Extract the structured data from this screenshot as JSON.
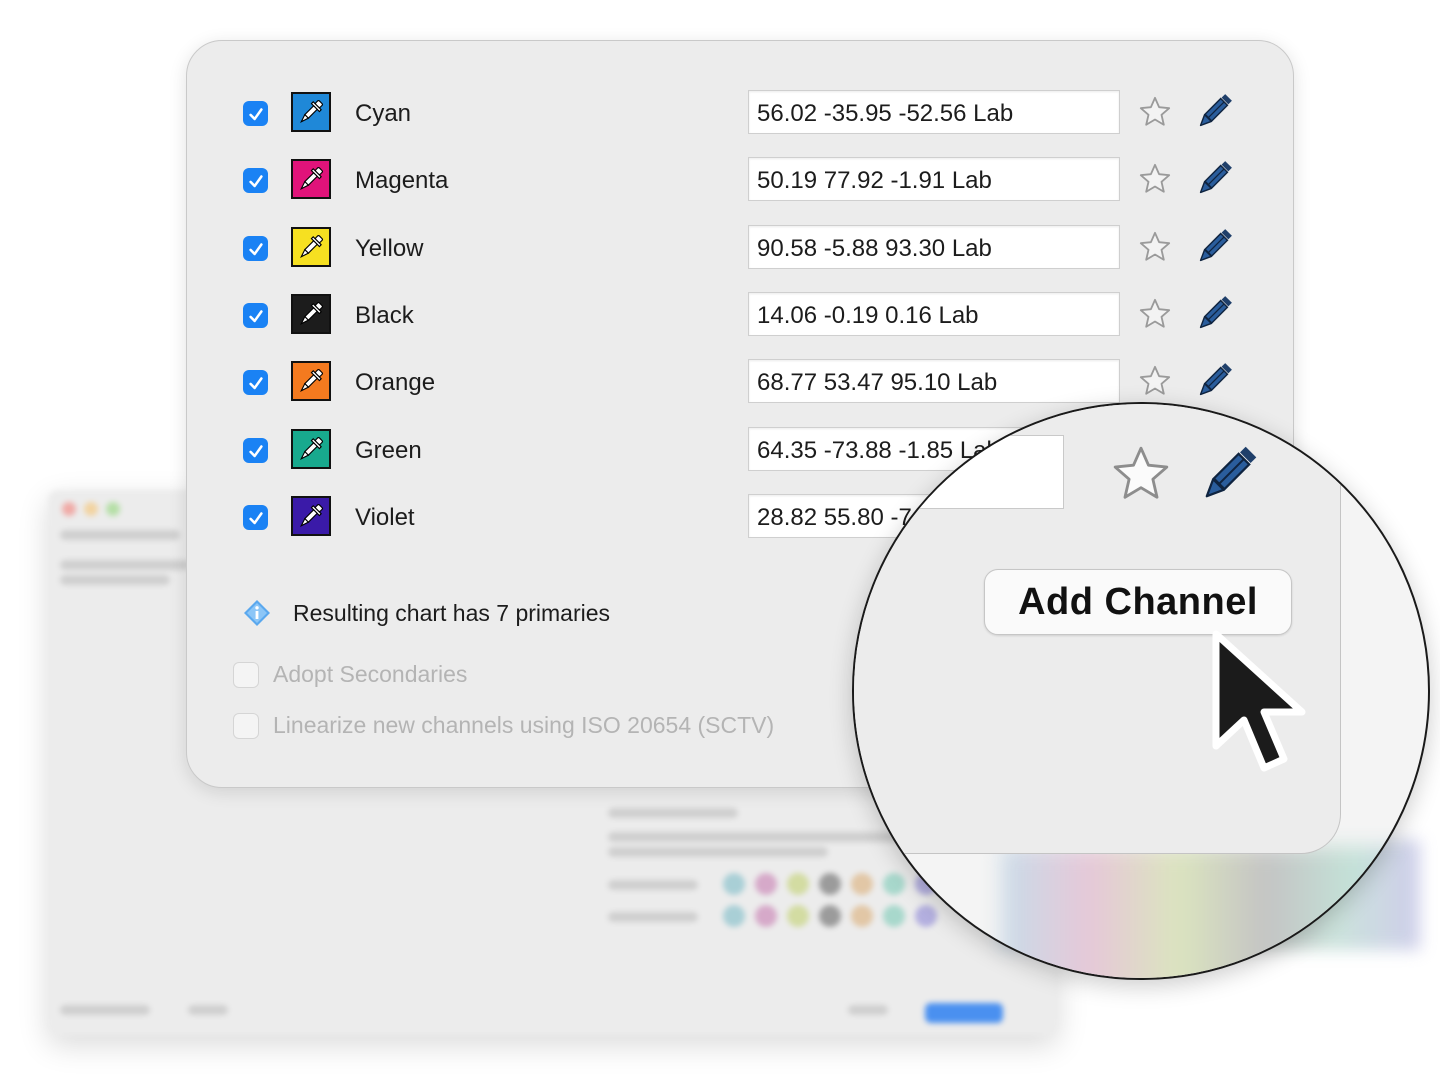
{
  "channels": [
    {
      "name": "Cyan",
      "value": "56.02 -35.95 -52.56 Lab",
      "color": "#1f88d8",
      "checked": true
    },
    {
      "name": "Magenta",
      "value": "50.19 77.92 -1.91 Lab",
      "color": "#e0137a",
      "checked": true
    },
    {
      "name": "Yellow",
      "value": "90.58 -5.88 93.30 Lab",
      "color": "#f6e021",
      "checked": true
    },
    {
      "name": "Black",
      "value": "14.06 -0.19 0.16 Lab",
      "color": "#1c1c1c",
      "checked": true
    },
    {
      "name": "Orange",
      "value": "68.77 53.47 95.10 Lab",
      "color": "#f47a1f",
      "checked": true
    },
    {
      "name": "Green",
      "value": "64.35 -73.88 -1.85 Lab",
      "color": "#18a98e",
      "checked": true
    },
    {
      "name": "Violet",
      "value": "28.82 55.80 -7",
      "color": "#3a1aa8",
      "checked": true
    }
  ],
  "info": {
    "text": "Resulting chart has 7 primaries",
    "icon": "info-diamond-icon"
  },
  "options": {
    "adopt_secondaries": "Adopt Secondaries",
    "linearize": "Linearize new channels using ISO 20654 (SCTV)"
  },
  "magnifier": {
    "button_label": "Add Channel"
  },
  "icons": {
    "favorite": "star-icon",
    "edit": "pencil-icon",
    "picker": "eyedropper-icon"
  },
  "colors": {
    "accent": "#1a82f4",
    "panel": "#ececec",
    "disabled_text": "#b4b4b4"
  }
}
